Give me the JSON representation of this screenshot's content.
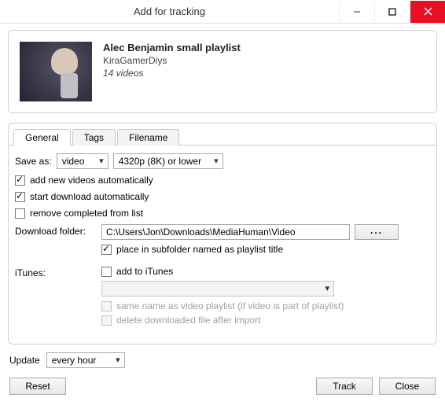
{
  "window": {
    "title": "Add for tracking"
  },
  "playlist": {
    "title": "Alec Benjamin small playlist",
    "author": "KiraGamerDiys",
    "count": "14 videos"
  },
  "tabs": {
    "general": "General",
    "tags": "Tags",
    "filename": "Filename"
  },
  "form": {
    "save_as_label": "Save as:",
    "format": "video",
    "quality": "4320p (8K) or lower",
    "add_new": "add new videos automatically",
    "start_dl": "start download automatically",
    "remove_done": "remove completed from list",
    "dl_folder_label": "Download folder:",
    "dl_folder_value": "C:\\Users\\Jon\\Downloads\\MediaHuman\\Video",
    "browse": "...",
    "subfolder": "place in subfolder named as playlist title",
    "itunes_label": "iTunes:",
    "add_itunes": "add to iTunes",
    "itunes_same": "same name as video playlist (if video is part of playlist)",
    "itunes_delete": "delete downloaded file after import"
  },
  "footer": {
    "update_label": "Update",
    "update_value": "every hour",
    "reset": "Reset",
    "track": "Track",
    "close": "Close"
  }
}
